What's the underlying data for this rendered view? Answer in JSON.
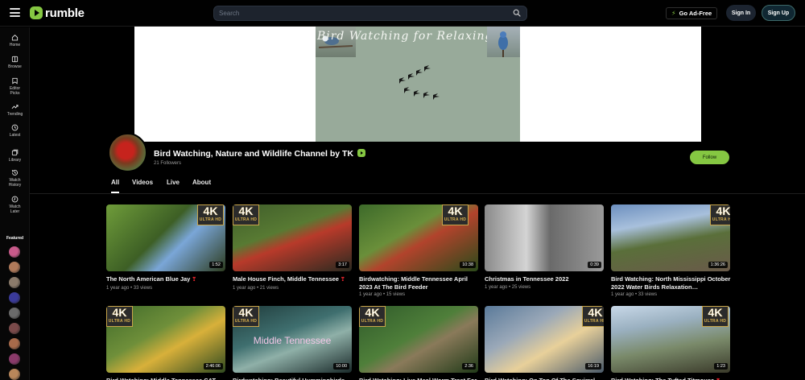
{
  "header": {
    "logo_text": "rumble",
    "search_placeholder": "Search",
    "adfree_label": "Go Ad-Free",
    "signin_label": "Sign In",
    "signup_label": "Sign Up"
  },
  "sidebar": {
    "items": [
      {
        "label": "Home",
        "icon": "home-icon"
      },
      {
        "label": "Browse",
        "icon": "browse-icon"
      },
      {
        "label": "Editor Picks",
        "icon": "editor-picks-icon"
      },
      {
        "label": "Trending",
        "icon": "trending-icon"
      },
      {
        "label": "Latest",
        "icon": "clock-icon"
      },
      {
        "label": "Library",
        "icon": "library-icon"
      },
      {
        "label": "Watch History",
        "icon": "history-icon"
      },
      {
        "label": "Watch Later",
        "icon": "watch-later-icon"
      }
    ],
    "featured_title": "Featured",
    "featured_colors": [
      "#c85a8a",
      "#b07a5a",
      "#8a7a6a",
      "#3a3a9a",
      "#6a6a6a",
      "#7a4a4a",
      "#a86a4a",
      "#8a3a6a",
      "#b8865a",
      "#c2185b"
    ]
  },
  "banner": {
    "title": "Bird Watching for Relaxingtion"
  },
  "channel": {
    "name": "Bird Watching, Nature and Wildlife Channel by TK",
    "followers": "21 Followers",
    "follow_label": "Follow"
  },
  "tabs": [
    {
      "label": "All",
      "active": true
    },
    {
      "label": "Videos",
      "active": false
    },
    {
      "label": "Live",
      "active": false
    },
    {
      "label": "About",
      "active": false
    }
  ],
  "uhd_badge": {
    "big": "4K",
    "small": "ULTRA HD"
  },
  "videos": [
    {
      "title": "The North American Blue Jay",
      "heart": true,
      "meta": "1 year ago • 33 views",
      "duration": "1:52",
      "uhd": true
    },
    {
      "title": "Male House Finch, Middle Tennessee",
      "heart": true,
      "meta": "1 year ago • 21 views",
      "duration": "3:17",
      "uhd": true
    },
    {
      "title": "Birdwatching: Middle Tennessee April 2023 At The Bird Feeder",
      "heart": false,
      "meta": "1 year ago • 15 views",
      "duration": "10:38",
      "uhd": true
    },
    {
      "title": "Christmas in Tennessee 2022",
      "heart": false,
      "meta": "1 year ago • 25 views",
      "duration": "0:39",
      "uhd": false
    },
    {
      "title": "Bird Watching: North Mississippi October 2022 Water Birds Relaxation…",
      "heart": false,
      "meta": "1 year ago • 33 views",
      "duration": "1:36:26",
      "uhd": true
    },
    {
      "title": "Bird Watching: Middle Tennessee CAT",
      "heart": false,
      "meta": "",
      "duration": "2:46:06",
      "uhd": true
    },
    {
      "title": "Birdwatching: Beautiful Hummingbirds",
      "heart": false,
      "meta": "",
      "duration": "10:00",
      "uhd": true,
      "overlay": "Middle Tennessee"
    },
    {
      "title": "Bird Watching: Live Meal Worm Treat For",
      "heart": false,
      "meta": "",
      "duration": "2:36",
      "uhd": true
    },
    {
      "title": "Bird Watching: On Top Of The Squirrel",
      "heart": false,
      "meta": "",
      "duration": "16:19",
      "uhd": true
    },
    {
      "title": "Bird Watching: The Tufted Titmouse",
      "heart": true,
      "meta": "",
      "duration": "1:23",
      "uhd": true
    }
  ]
}
